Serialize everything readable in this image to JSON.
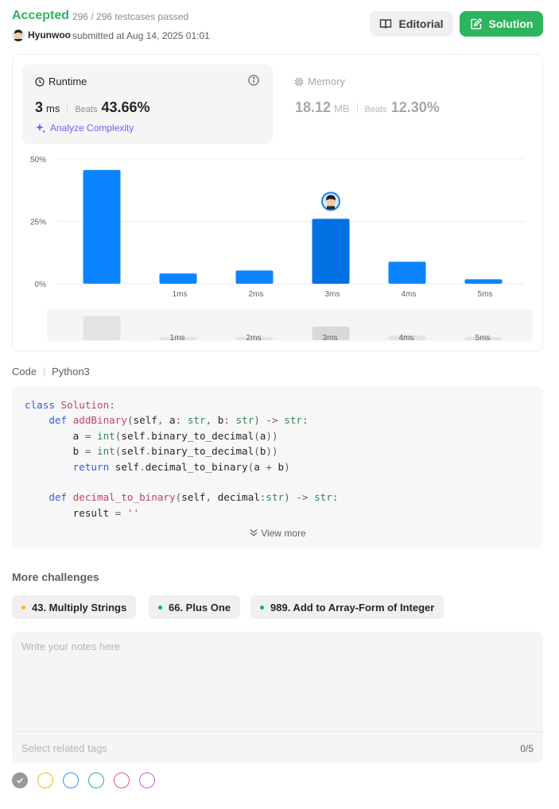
{
  "header": {
    "status": "Accepted",
    "testcases": "296 / 296 testcases passed",
    "username": "Hyunwoo",
    "submitted": "submitted at Aug 14, 2025 01:01",
    "editorial_label": "Editorial",
    "solution_label": "Solution"
  },
  "runtime": {
    "title": "Runtime",
    "value": "3",
    "unit": "ms",
    "beats_label": "Beats",
    "beats": "43.66%",
    "analyze_label": "Analyze Complexity"
  },
  "memory": {
    "title": "Memory",
    "value": "18.12",
    "unit": "MB",
    "beats_label": "Beats",
    "beats": "12.30%"
  },
  "chart_data": {
    "type": "bar",
    "categories": [
      "",
      "1ms",
      "2ms",
      "3ms",
      "4ms",
      "5ms"
    ],
    "values": [
      45.6,
      4.1,
      5.3,
      26.0,
      8.8,
      1.8
    ],
    "ytick_labels": [
      "50%",
      "25%",
      "0%"
    ],
    "ylim": [
      0,
      50
    ],
    "highlighted_category": "3ms",
    "colors": {
      "bar": "#0a84ff",
      "bar_highlight": "#0071e3",
      "grid": "#ececec"
    }
  },
  "code": {
    "label": "Code",
    "language": "Python3",
    "view_more": "View more"
  },
  "challenges": {
    "title": "More challenges",
    "items": [
      {
        "label": "43. Multiply Strings",
        "color": "#ffb800"
      },
      {
        "label": "66. Plus One",
        "color": "#00af9b"
      },
      {
        "label": "989. Add to Array-Form of Integer",
        "color": "#00af9b"
      }
    ]
  },
  "notes": {
    "placeholder": "Write your notes here",
    "tags_label": "Select related tags",
    "tags_count": "0/5"
  },
  "color_tags": [
    "#999999",
    "#ffb800",
    "#3b8cf0",
    "#2db55d",
    "#e84b9b",
    "#c05ad8"
  ]
}
